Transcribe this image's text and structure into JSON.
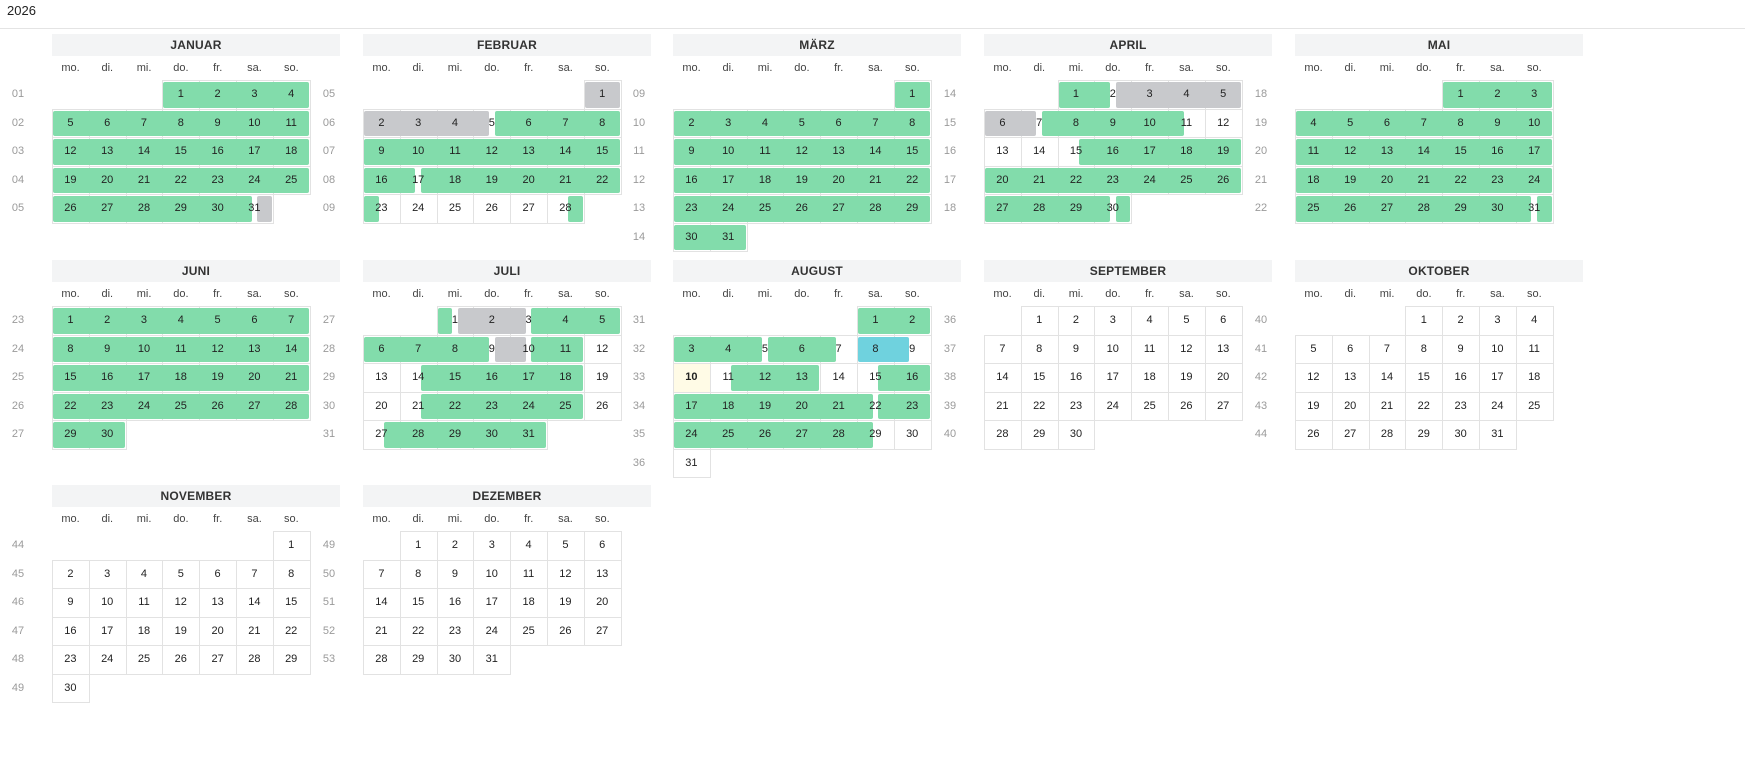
{
  "year": "2026",
  "weekday_labels": [
    "mo.",
    "di.",
    "mi.",
    "do.",
    "fr.",
    "sa.",
    "so."
  ],
  "colors": {
    "green": "#82dcab",
    "gray": "#c8c9cc",
    "cyan": "#6fd2de",
    "today": "#fffbe6"
  },
  "today": {
    "month": 8,
    "day": 10
  },
  "months": [
    {
      "num": 1,
      "name": "JANUAR",
      "offset": 3,
      "days": 31,
      "week_numbers": [
        "01",
        "02",
        "03",
        "04",
        "05"
      ],
      "bars": [
        {
          "color": "green",
          "from": 1,
          "to": 4
        },
        {
          "color": "green",
          "from": 5,
          "to": 11
        },
        {
          "color": "green",
          "from": 12,
          "to": 18
        },
        {
          "color": "green",
          "from": 19,
          "to": 25
        },
        {
          "color": "green",
          "from": 26,
          "to": 31,
          "endFrac": 0.45
        },
        {
          "color": "gray",
          "from": 31,
          "to": 31,
          "startFrac": 0.55
        }
      ]
    },
    {
      "num": 2,
      "name": "FEBRUAR",
      "offset": 6,
      "days": 28,
      "week_numbers": [
        "05",
        "06",
        "07",
        "08",
        "09"
      ],
      "bars": [
        {
          "color": "gray",
          "from": 1,
          "to": 1
        },
        {
          "color": "gray",
          "from": 2,
          "to": 5,
          "endFrac": 0.45
        },
        {
          "color": "green",
          "from": 5,
          "to": 8,
          "startFrac": 0.55
        },
        {
          "color": "green",
          "from": 9,
          "to": 15
        },
        {
          "color": "green",
          "from": 16,
          "to": 17,
          "endFrac": 0.45
        },
        {
          "color": "green",
          "from": 17,
          "to": 22,
          "startFrac": 0.55
        },
        {
          "color": "green",
          "from": 23,
          "to": 23,
          "endFrac": 0.45
        },
        {
          "color": "green",
          "from": 28,
          "to": 28,
          "startFrac": 0.55
        }
      ]
    },
    {
      "num": 3,
      "name": "MÄRZ",
      "offset": 6,
      "days": 31,
      "week_numbers": [
        "09",
        "10",
        "11",
        "12",
        "13",
        "14"
      ],
      "bars": [
        {
          "color": "green",
          "from": 1,
          "to": 1
        },
        {
          "color": "green",
          "from": 2,
          "to": 8
        },
        {
          "color": "green",
          "from": 9,
          "to": 15
        },
        {
          "color": "green",
          "from": 16,
          "to": 22
        },
        {
          "color": "green",
          "from": 23,
          "to": 29
        },
        {
          "color": "green",
          "from": 30,
          "to": 31
        }
      ]
    },
    {
      "num": 4,
      "name": "APRIL",
      "offset": 2,
      "days": 30,
      "week_numbers": [
        "14",
        "15",
        "16",
        "17",
        "18"
      ],
      "bars": [
        {
          "color": "green",
          "from": 1,
          "to": 2,
          "endFrac": 0.45
        },
        {
          "color": "gray",
          "from": 2,
          "to": 5,
          "startFrac": 0.55
        },
        {
          "color": "gray",
          "from": 6,
          "to": 7,
          "endFrac": 0.45
        },
        {
          "color": "green",
          "from": 7,
          "to": 11,
          "startFrac": 0.55,
          "endFrac": 0.45
        },
        {
          "color": "green",
          "from": 15,
          "to": 19,
          "startFrac": 0.55
        },
        {
          "color": "green",
          "from": 20,
          "to": 26
        },
        {
          "color": "green",
          "from": 27,
          "to": 30,
          "endFrac": 0.45
        },
        {
          "color": "green",
          "from": 30,
          "to": 30,
          "startFrac": 0.55
        }
      ]
    },
    {
      "num": 5,
      "name": "MAI",
      "offset": 4,
      "days": 31,
      "week_numbers": [
        "18",
        "19",
        "20",
        "21",
        "22"
      ],
      "bars": [
        {
          "color": "green",
          "from": 1,
          "to": 3
        },
        {
          "color": "green",
          "from": 4,
          "to": 10
        },
        {
          "color": "green",
          "from": 11,
          "to": 17
        },
        {
          "color": "green",
          "from": 18,
          "to": 24
        },
        {
          "color": "green",
          "from": 25,
          "to": 31,
          "endFrac": 0.45
        },
        {
          "color": "green",
          "from": 31,
          "to": 31,
          "startFrac": 0.55
        }
      ]
    },
    {
      "num": 6,
      "name": "JUNI",
      "offset": 0,
      "days": 30,
      "week_numbers": [
        "23",
        "24",
        "25",
        "26",
        "27"
      ],
      "bars": [
        {
          "color": "green",
          "from": 1,
          "to": 7
        },
        {
          "color": "green",
          "from": 8,
          "to": 14
        },
        {
          "color": "green",
          "from": 15,
          "to": 21
        },
        {
          "color": "green",
          "from": 22,
          "to": 28
        },
        {
          "color": "green",
          "from": 29,
          "to": 30
        }
      ]
    },
    {
      "num": 7,
      "name": "JULI",
      "offset": 2,
      "days": 31,
      "week_numbers": [
        "27",
        "28",
        "29",
        "30",
        "31"
      ],
      "bars": [
        {
          "color": "green",
          "from": 1,
          "to": 1,
          "endFrac": 0.45
        },
        {
          "color": "gray",
          "from": 1,
          "to": 3,
          "startFrac": 0.55,
          "endFrac": 0.45
        },
        {
          "color": "green",
          "from": 3,
          "to": 5,
          "startFrac": 0.55
        },
        {
          "color": "green",
          "from": 6,
          "to": 9,
          "endFrac": 0.45
        },
        {
          "color": "gray",
          "from": 9,
          "to": 10,
          "startFrac": 0.55,
          "endFrac": 0.45
        },
        {
          "color": "green",
          "from": 10,
          "to": 11,
          "startFrac": 0.55
        },
        {
          "color": "green",
          "from": 14,
          "to": 18,
          "startFrac": 0.55
        },
        {
          "color": "green",
          "from": 21,
          "to": 25,
          "startFrac": 0.55
        },
        {
          "color": "green",
          "from": 27,
          "to": 31,
          "startFrac": 0.55
        }
      ]
    },
    {
      "num": 8,
      "name": "AUGUST",
      "offset": 5,
      "days": 31,
      "week_numbers": [
        "31",
        "32",
        "33",
        "34",
        "35",
        "36"
      ],
      "bars": [
        {
          "color": "green",
          "from": 1,
          "to": 2
        },
        {
          "color": "green",
          "from": 3,
          "to": 5,
          "endFrac": 0.45
        },
        {
          "color": "green",
          "from": 5,
          "to": 7,
          "startFrac": 0.55,
          "endFrac": 0.45
        },
        {
          "color": "cyan",
          "from": 8,
          "to": 9,
          "endFrac": 0.45
        },
        {
          "color": "green",
          "from": 11,
          "to": 13,
          "startFrac": 0.55
        },
        {
          "color": "green",
          "from": 15,
          "to": 16,
          "startFrac": 0.55
        },
        {
          "color": "green",
          "from": 17,
          "to": 22,
          "endFrac": 0.45
        },
        {
          "color": "green",
          "from": 22,
          "to": 23,
          "startFrac": 0.55
        },
        {
          "color": "green",
          "from": 24,
          "to": 29,
          "endFrac": 0.45
        }
      ]
    },
    {
      "num": 9,
      "name": "SEPTEMBER",
      "offset": 1,
      "days": 30,
      "week_numbers": [
        "36",
        "37",
        "38",
        "39",
        "40"
      ],
      "bars": []
    },
    {
      "num": 10,
      "name": "OKTOBER",
      "offset": 3,
      "days": 31,
      "week_numbers": [
        "40",
        "41",
        "42",
        "43",
        "44"
      ],
      "bars": []
    },
    {
      "num": 11,
      "name": "NOVEMBER",
      "offset": 6,
      "days": 30,
      "week_numbers": [
        "44",
        "45",
        "46",
        "47",
        "48",
        "49"
      ],
      "bars": []
    },
    {
      "num": 12,
      "name": "DEZEMBER",
      "offset": 1,
      "days": 31,
      "week_numbers": [
        "49",
        "50",
        "51",
        "52",
        "53"
      ],
      "bars": []
    }
  ]
}
